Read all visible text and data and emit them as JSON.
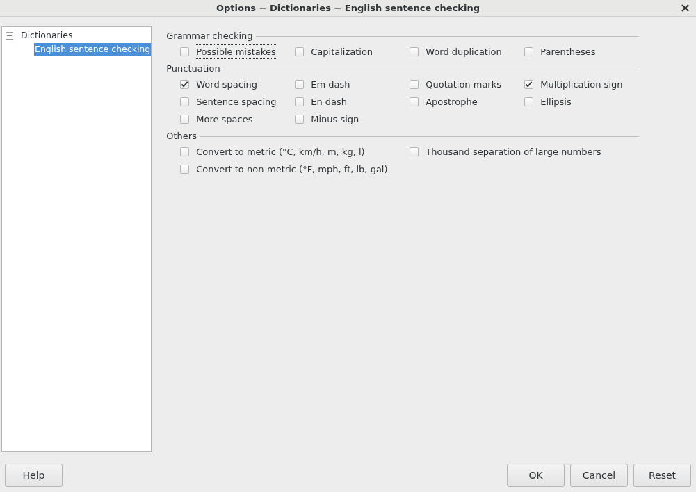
{
  "window": {
    "title": "Options − Dictionaries − English sentence checking",
    "close": "×"
  },
  "tree": {
    "items": [
      {
        "label": "Dictionaries",
        "expanded": true,
        "selected": false,
        "children": [
          {
            "label": "English sentence checking",
            "selected": true
          }
        ]
      }
    ]
  },
  "sections": [
    {
      "title": "Grammar checking",
      "kind": "narrow",
      "options": [
        {
          "label": "Possible mistakes",
          "checked": false,
          "focused": true
        },
        {
          "label": "Capitalization",
          "checked": false,
          "focused": false
        },
        {
          "label": "Word duplication",
          "checked": false,
          "focused": false
        },
        {
          "label": "Parentheses",
          "checked": false,
          "focused": false
        }
      ]
    },
    {
      "title": "Punctuation",
      "kind": "narrow",
      "options": [
        {
          "label": "Word spacing",
          "checked": true,
          "focused": false
        },
        {
          "label": "Em dash",
          "checked": false,
          "focused": false
        },
        {
          "label": "Quotation marks",
          "checked": false,
          "focused": false
        },
        {
          "label": "Multiplication sign",
          "checked": true,
          "focused": false
        },
        {
          "label": "Sentence spacing",
          "checked": false,
          "focused": false
        },
        {
          "label": "En dash",
          "checked": false,
          "focused": false
        },
        {
          "label": "Apostrophe",
          "checked": false,
          "focused": false
        },
        {
          "label": "Ellipsis",
          "checked": false,
          "focused": false
        },
        {
          "label": "More spaces",
          "checked": false,
          "focused": false
        },
        {
          "label": "Minus sign",
          "checked": false,
          "focused": false
        }
      ]
    },
    {
      "title": "Others",
      "kind": "wide",
      "options": [
        {
          "label": "Convert to metric (°C, km/h, m, kg, l)",
          "checked": false,
          "focused": false
        },
        {
          "label": "Thousand separation of large numbers",
          "checked": false,
          "focused": false
        },
        {
          "label": "Convert to non-metric (°F, mph, ft, lb, gal)",
          "checked": false,
          "focused": false
        }
      ]
    }
  ],
  "buttons_left": [
    "Help"
  ],
  "buttons_right": [
    "OK",
    "Cancel",
    "Reset"
  ]
}
